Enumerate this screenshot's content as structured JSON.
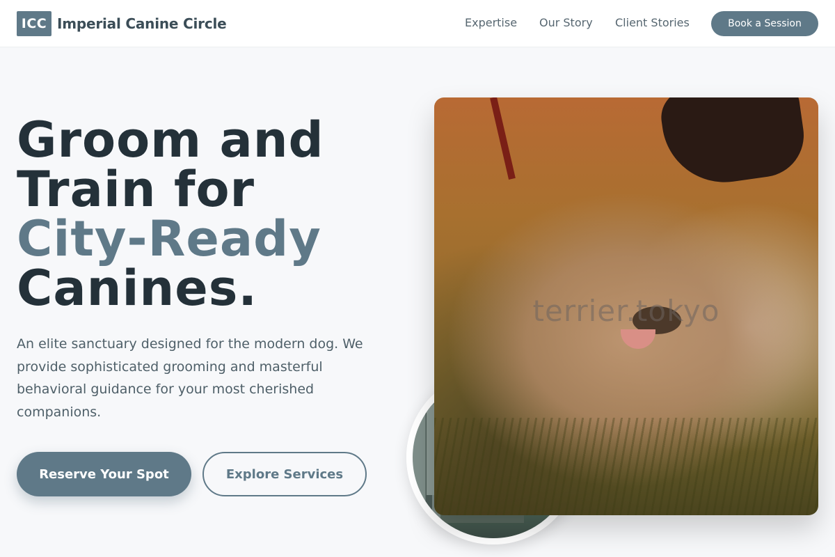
{
  "header": {
    "logo_badge": "ICC",
    "brand_name": "Imperial Canine Circle",
    "nav": [
      "Expertise",
      "Our Story",
      "Client Stories"
    ],
    "cta_label": "Book a Session"
  },
  "hero": {
    "headline_lines": [
      "Groom and",
      "Train for",
      "City-Ready",
      "Canines."
    ],
    "subtitle": "An elite sanctuary designed for the modern dog. We provide sophisticated grooming and masterful behavioral guidance for your most cherished companions.",
    "primary_button": "Reserve Your Spot",
    "secondary_button": "Explore Services",
    "photo_watermark": "terrier.tokyo"
  },
  "colors": {
    "accent": "#5f7988",
    "headline": "#243139",
    "background": "#f7f8fa"
  }
}
